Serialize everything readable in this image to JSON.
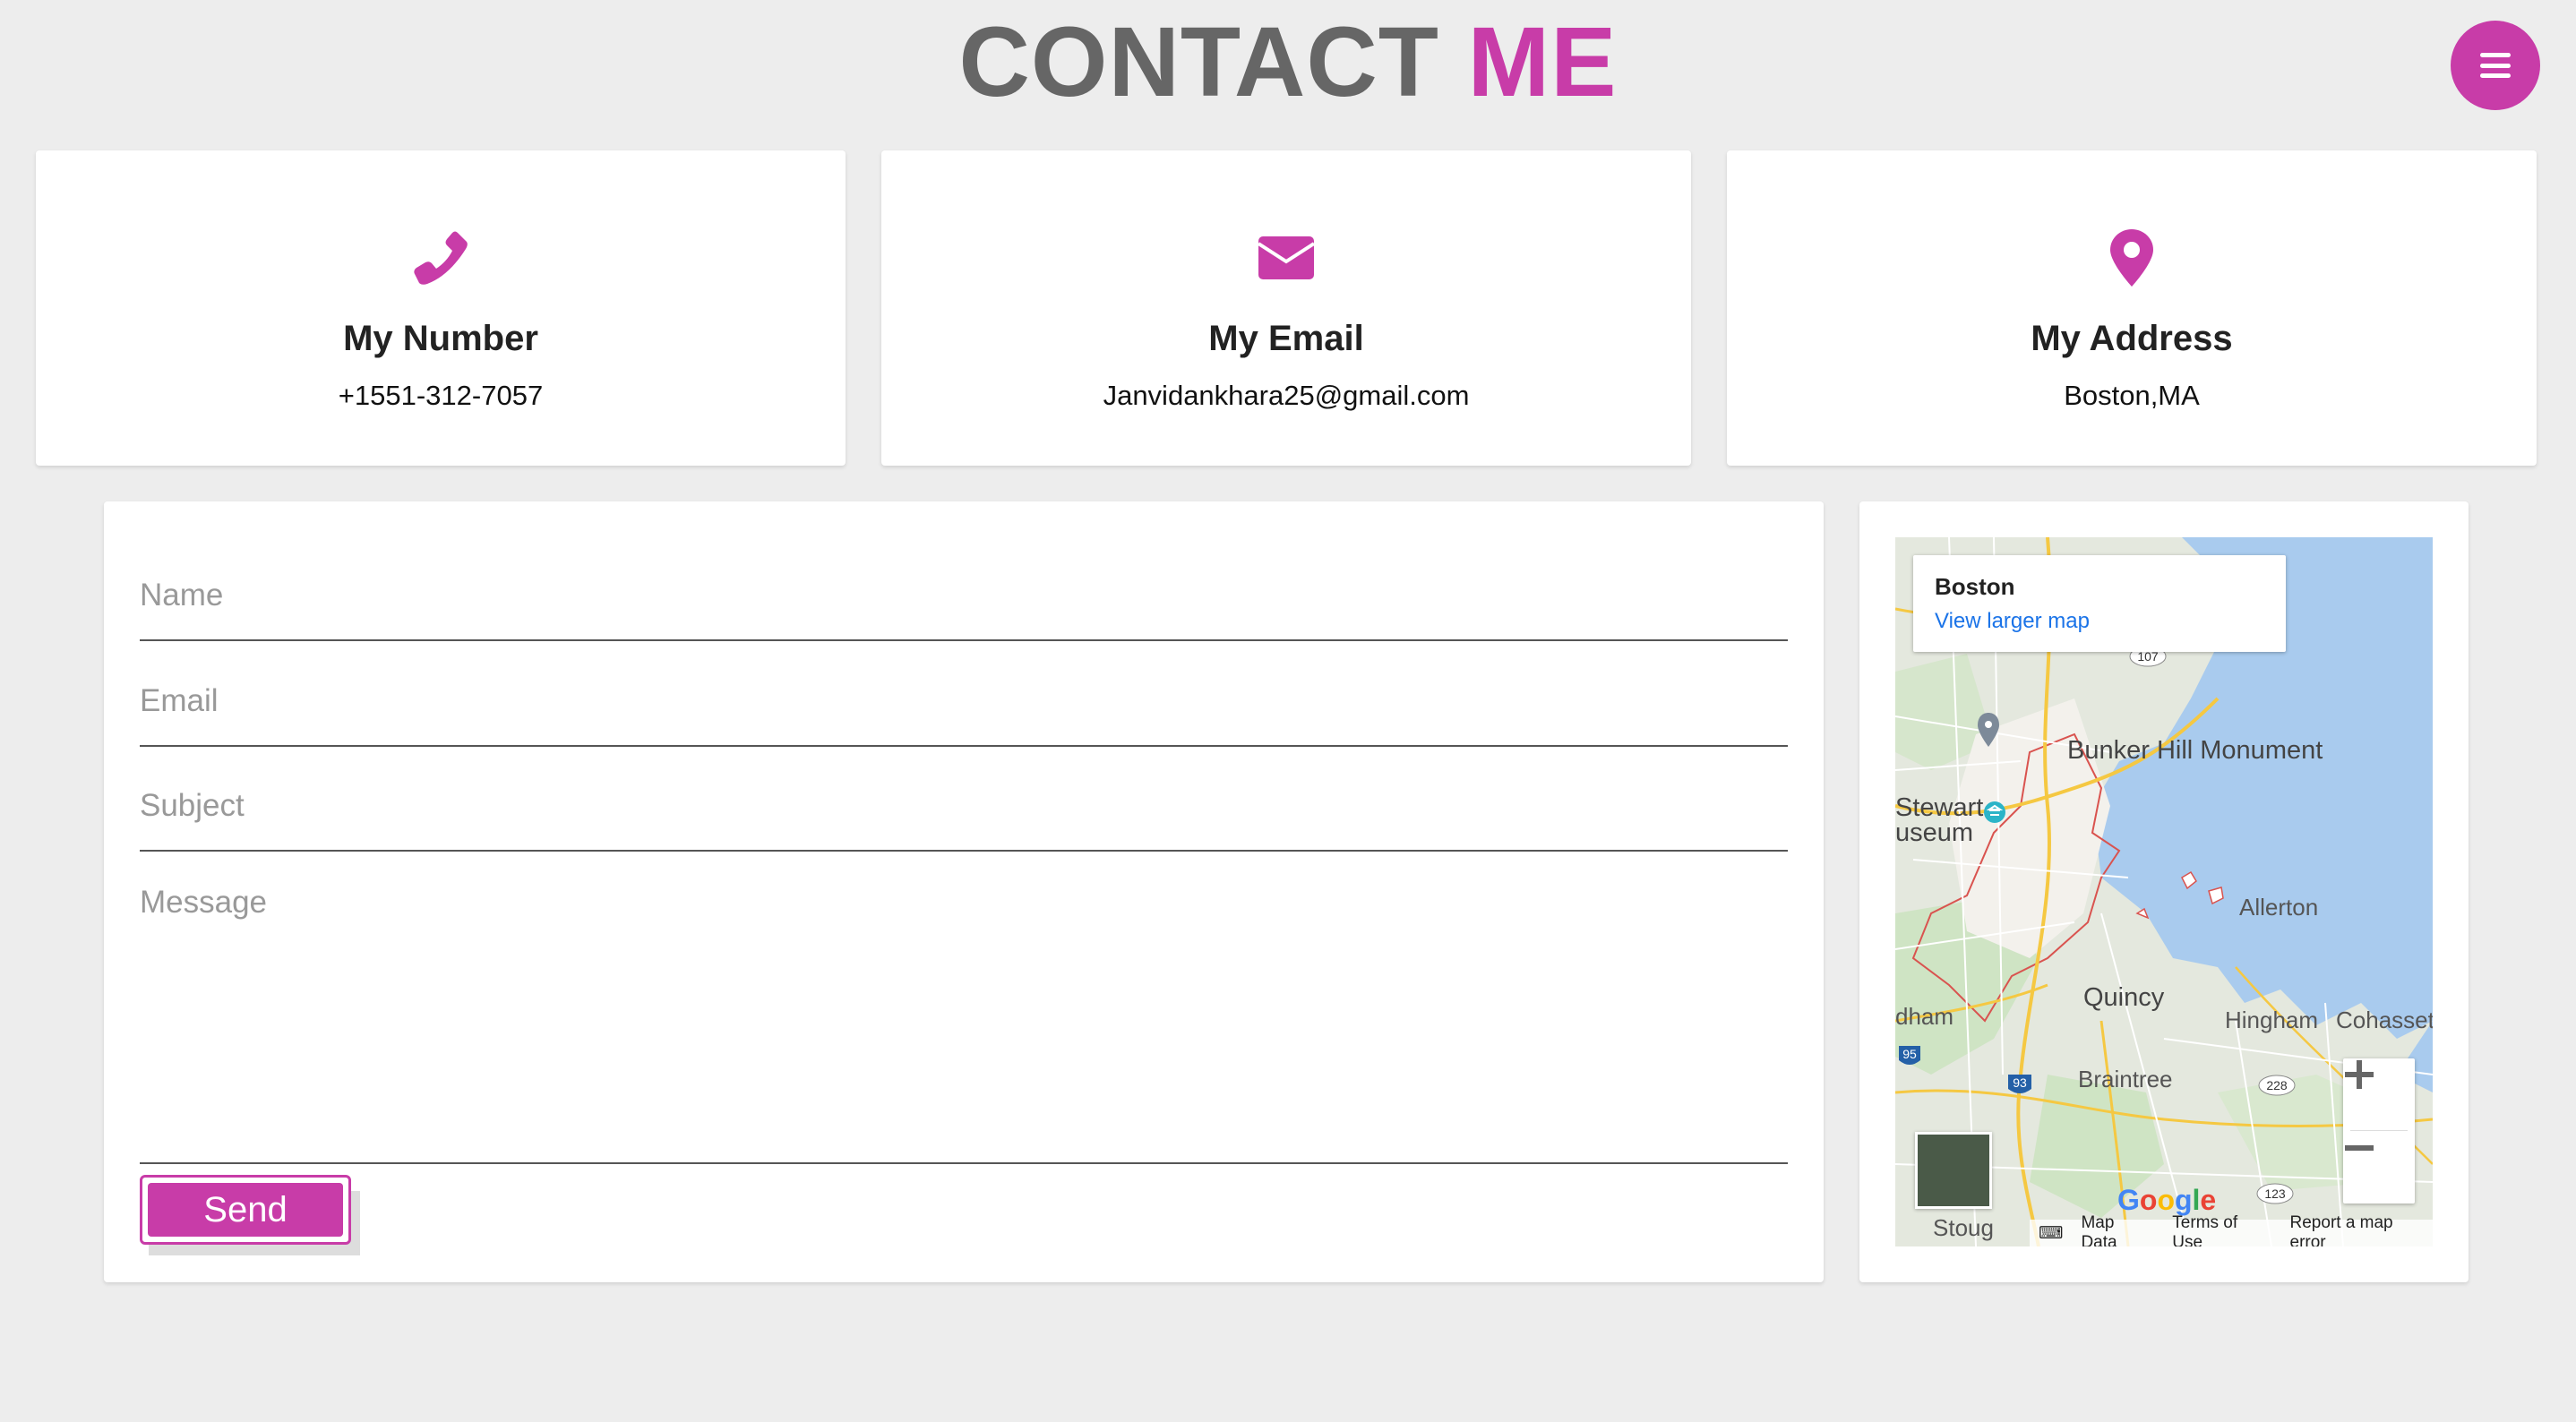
{
  "header": {
    "title_main": "CONTACT",
    "title_accent": "ME",
    "menu_icon": "hamburger-menu-icon"
  },
  "colors": {
    "accent": "#c83ca8",
    "background": "#ededed",
    "title_gray": "#666666"
  },
  "cards": [
    {
      "icon": "phone-icon",
      "title": "My Number",
      "value": "+1551-312-7057"
    },
    {
      "icon": "envelope-icon",
      "title": "My Email",
      "value": "Janvidankhara25@gmail.com"
    },
    {
      "icon": "map-pin-icon",
      "title": "My Address",
      "value": "Boston,MA"
    }
  ],
  "form": {
    "name_placeholder": "Name",
    "email_placeholder": "Email",
    "subject_placeholder": "Subject",
    "message_placeholder": "Message",
    "send_label": "Send"
  },
  "map": {
    "place_name": "Boston",
    "view_larger_link": "View larger map",
    "labels": {
      "bunker_hill": "Bunker Hill Monument",
      "stewart": "Stewart",
      "museum": "useum",
      "allerton": "Allerton",
      "quincy": "Quincy",
      "hingham": "Hingham",
      "cohasset": "Cohasset",
      "braintree": "Braintree",
      "dham": "dham",
      "stoug": "Stoug"
    },
    "route_shields": [
      "95",
      "93",
      "228",
      "123",
      "107"
    ],
    "google_logo": "Google",
    "attribution": {
      "map_data": "Map Data",
      "terms": "Terms of Use",
      "report": "Report a map error"
    }
  }
}
